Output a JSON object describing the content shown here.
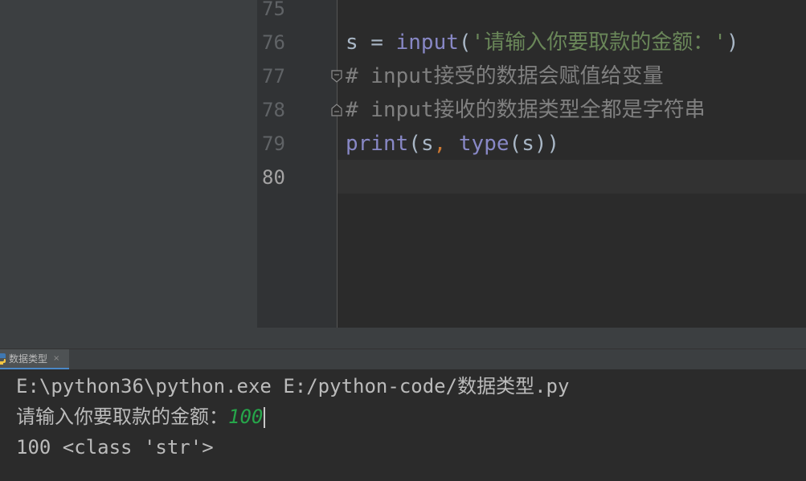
{
  "editor": {
    "line_numbers": [
      "75",
      "76",
      "77",
      "78",
      "79",
      "80"
    ],
    "lines": {
      "l76": {
        "var": "s",
        "op": " = ",
        "fn": "input",
        "open": "(",
        "str": "'请输入你要取款的金额：'",
        "close": ")"
      },
      "l77": {
        "comment": "# input接受的数据会赋值给变量"
      },
      "l78": {
        "comment": "# input接收的数据类型全都是字符串"
      },
      "l79": {
        "fn1": "print",
        "open1": "(",
        "arg1": "s",
        "comma": ",",
        "space": " ",
        "fn2": "type",
        "open2": "(",
        "arg2": "s",
        "close": "))"
      }
    }
  },
  "run_panel": {
    "tab": {
      "label": "数据类型",
      "close": "×",
      "icon": "python-icon"
    },
    "console": {
      "line1": "E:\\python36\\python.exe E:/python-code/数据类型.py",
      "line2_prompt": "请输入你要取款的金额：",
      "line2_input": "100",
      "line3": "100 <class 'str'>"
    }
  },
  "colors": {
    "background": "#2b2b2b",
    "panel": "#3c3f41",
    "builtin": "#8888c6",
    "string": "#6a8759",
    "comment": "#808080",
    "console_input": "#26a64a",
    "tab_underline": "#4a88c7"
  }
}
